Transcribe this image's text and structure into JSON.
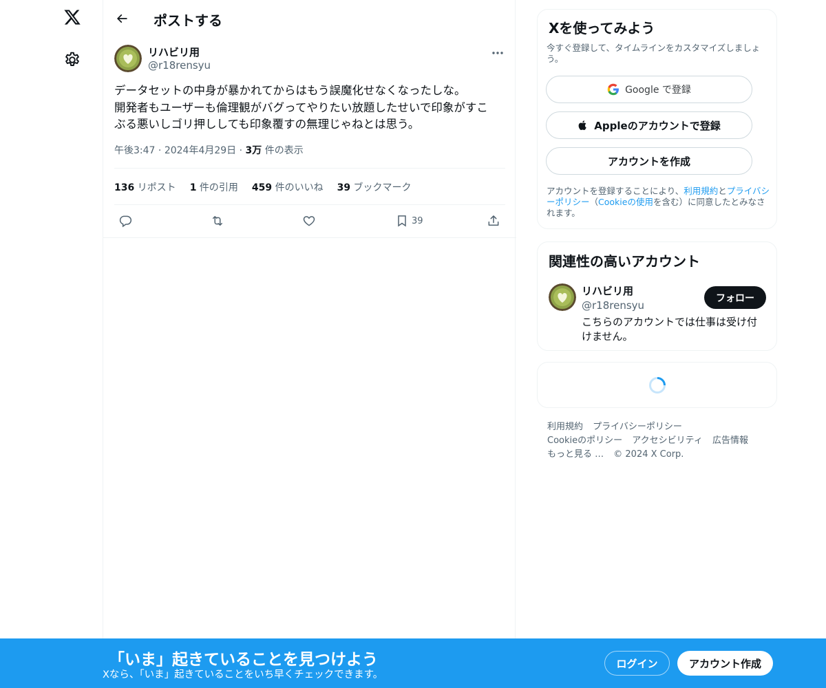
{
  "header": {
    "title": "ポストする"
  },
  "tweet": {
    "author_name": "リハビリ用",
    "author_handle": "@r18rensyu",
    "text_lines": [
      "データセットの中身が暴かれてからはもう誤魔化せなくなったしな。",
      "開発者もユーザーも倫理観がバグってやりたい放題したせいで印象がすこ",
      "ぶる悪いしゴリ押ししても印象覆すの無理じゃねとは思う。"
    ],
    "time": "午後3:47",
    "date": "2024年4月29日",
    "views_count": "3万",
    "views_label": "件の表示",
    "stats": {
      "reposts_count": "136",
      "reposts_label": "リポスト",
      "quotes_count": "1",
      "quotes_label": "件の引用",
      "likes_count": "459",
      "likes_label": "件のいいね",
      "bookmarks_count": "39",
      "bookmarks_label": "ブックマーク"
    },
    "bookmark_action_count": "39"
  },
  "signup": {
    "title": "Xを使ってみよう",
    "subtitle": "今すぐ登録して、タイムラインをカスタマイズしましょう。",
    "google_label": "Google で登録",
    "apple_label": "Appleのアカウントで登録",
    "create_label": "アカウントを作成",
    "legal_1": "アカウントを登録することにより、",
    "legal_terms": "利用規約",
    "legal_and": "と",
    "legal_privacy": "プライバシーポリシー",
    "legal_paren_open": "（",
    "legal_cookie": "Cookieの使用",
    "legal_2": "を含む）に同意したとみなされます。"
  },
  "related": {
    "title": "関連性の高いアカウント",
    "name": "リハビリ用",
    "handle": "@r18rensyu",
    "follow_label": "フォロー",
    "bio": "こちらのアカウントでは仕事は受け付けません。"
  },
  "footer": {
    "terms": "利用規約",
    "privacy": "プライバシーポリシー",
    "cookie": "Cookieのポリシー",
    "accessibility": "アクセシビリティ",
    "ads": "広告情報",
    "more": "もっと見る …",
    "copyright": "© 2024 X Corp."
  },
  "banner": {
    "title": "「いま」起きていることを見つけよう",
    "subtitle": "Xなら、「いま」起きていることをいち早くチェックできます。",
    "login_label": "ログイン",
    "create_label": "アカウント作成"
  },
  "colors": {
    "accent": "#1d9bf0",
    "text": "#0f1419",
    "secondary": "#536471",
    "border": "#eff3f4"
  }
}
